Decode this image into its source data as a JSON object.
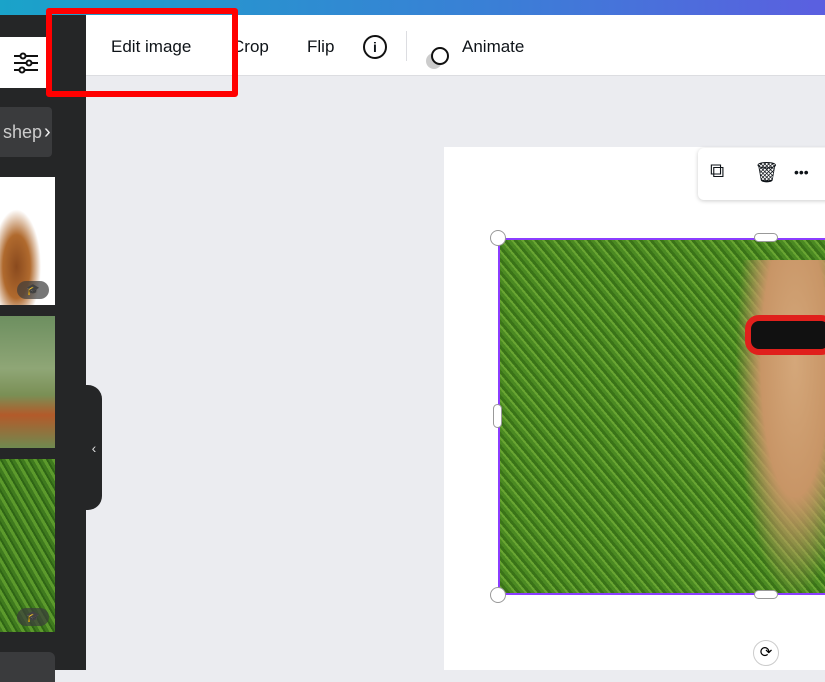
{
  "toolbar": {
    "edit_image": "Edit image",
    "crop": "Crop",
    "flip": "Flip",
    "animate": "Animate"
  },
  "sidebar": {
    "filter_chip": "n shep",
    "collapse": "‹"
  },
  "floating_toolbar": {
    "more": "•••"
  },
  "colors": {
    "accent": "#8b3dff",
    "highlight": "#ff0000"
  }
}
